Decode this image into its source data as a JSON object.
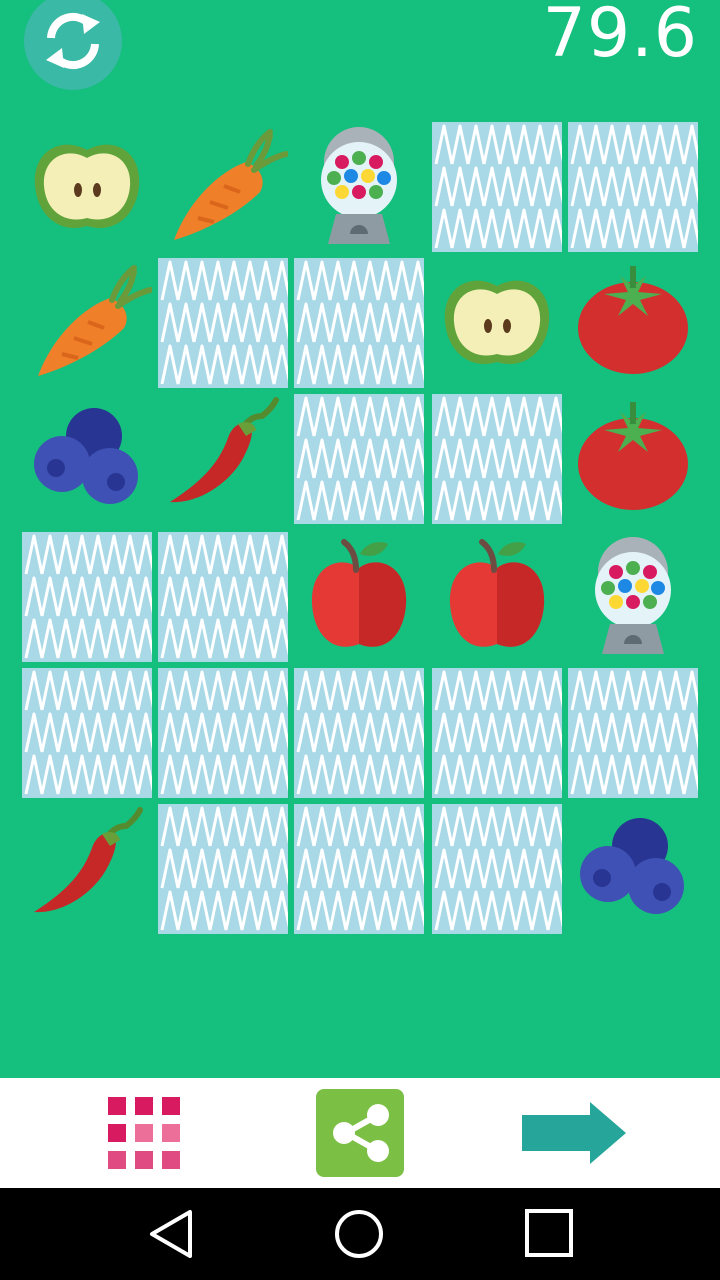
{
  "header": {
    "timer": "79.6",
    "restart_icon": "refresh-icon"
  },
  "board": {
    "rows": 6,
    "cols": 5,
    "cards": [
      [
        "apple-half",
        "carrot",
        "gumball",
        "hidden",
        "hidden"
      ],
      [
        "carrot",
        "hidden",
        "hidden",
        "apple-half",
        "tomato"
      ],
      [
        "blueberries",
        "chili",
        "hidden",
        "hidden",
        "tomato"
      ],
      [
        "hidden",
        "hidden",
        "apple",
        "apple",
        "gumball"
      ],
      [
        "hidden",
        "hidden",
        "hidden",
        "hidden",
        "hidden"
      ],
      [
        "chili",
        "hidden",
        "hidden",
        "hidden",
        "blueberries"
      ]
    ]
  },
  "bottom_bar": {
    "grid_icon": "grid-menu-icon",
    "share_icon": "share-icon",
    "next_icon": "arrow-right-icon"
  },
  "nav": {
    "back_icon": "back-triangle-icon",
    "home_icon": "home-circle-icon",
    "recents_icon": "recents-square-icon"
  },
  "colors": {
    "background": "#15bf7d",
    "card_back": "#a9d9e6",
    "share": "#7cbf45",
    "arrow": "#26a69a",
    "grid": "#d81b60"
  }
}
